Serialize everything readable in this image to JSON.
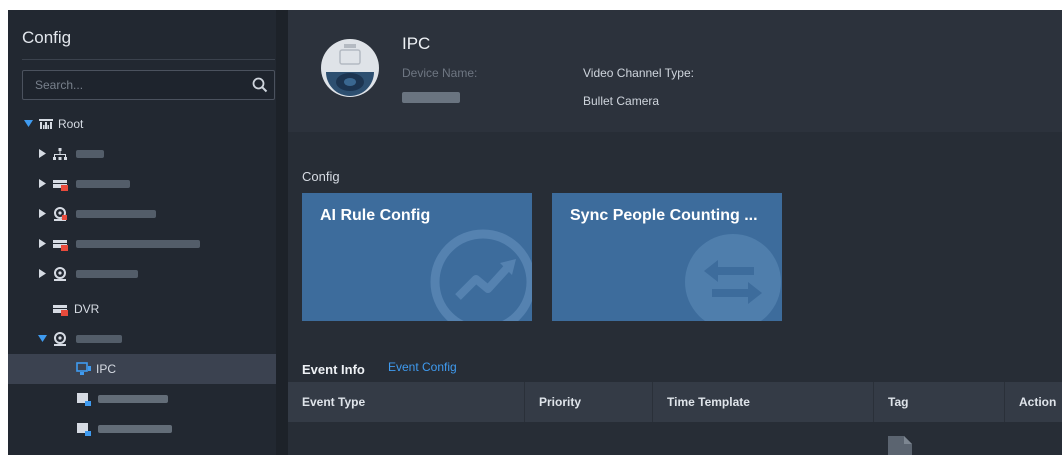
{
  "sidebar": {
    "title": "Config",
    "search": {
      "placeholder": "Search..."
    },
    "tree": {
      "root_label": "Root",
      "dvr_label": "DVR",
      "ipc_label": "IPC"
    }
  },
  "device": {
    "title": "IPC",
    "name_key": "Device Name:",
    "video_channel_type_key": "Video Channel Type:",
    "video_channel_type_value": "Bullet Camera"
  },
  "config": {
    "section_label": "Config",
    "cards": [
      {
        "title": "AI Rule Config"
      },
      {
        "title": "Sync People Counting ..."
      }
    ]
  },
  "events": {
    "title": "Event Info",
    "link_label": "Event Config",
    "columns": [
      "Event Type",
      "Priority",
      "Time Template",
      "Tag",
      "Action"
    ]
  },
  "colors": {
    "sidebar_bg": "#222831",
    "main_bg": "#272d36",
    "card_bg": "#3d6c9c",
    "selected_row": "#3b4250",
    "link": "#3f9bf0"
  }
}
